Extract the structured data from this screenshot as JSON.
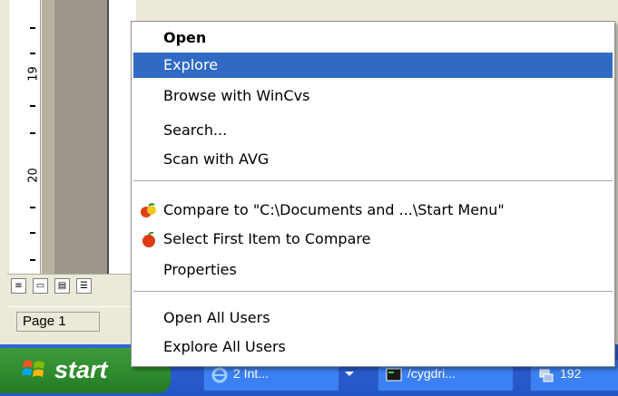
{
  "background_window": {
    "ruler_numbers": [
      "19",
      "20"
    ],
    "view_buttons": [
      "normal-view",
      "web-layout-view",
      "print-layout-view",
      "outline-view"
    ],
    "status": {
      "page_label": "Page 1"
    }
  },
  "context_menu": {
    "items": [
      {
        "label": "Open",
        "bold": true
      },
      {
        "label": "Explore",
        "selected": true
      },
      {
        "label": "Browse with WinCvs"
      },
      {
        "label": "Search..."
      },
      {
        "label": "Scan with AVG"
      },
      {
        "label": "Compare to \"C:\\Documents and ...\\Start Menu\"",
        "icon": "compare-fruit-icon"
      },
      {
        "label": "Select First Item to Compare",
        "icon": "apple-icon"
      },
      {
        "label": "Properties"
      },
      {
        "label": "Open All Users"
      },
      {
        "label": "Explore All Users"
      }
    ],
    "highlight_color": "#316ac5"
  },
  "taskbar": {
    "start_label": "start",
    "items": [
      {
        "label": "2 Int...",
        "icon": "internet-explorer-icon"
      },
      {
        "label": "/cygdri...",
        "icon": "terminal-icon"
      },
      {
        "label": "192",
        "icon": "network-icon"
      }
    ],
    "colors": {
      "taskbar_blue": "#2a5cd0",
      "start_green": "#2d8a2d"
    }
  }
}
